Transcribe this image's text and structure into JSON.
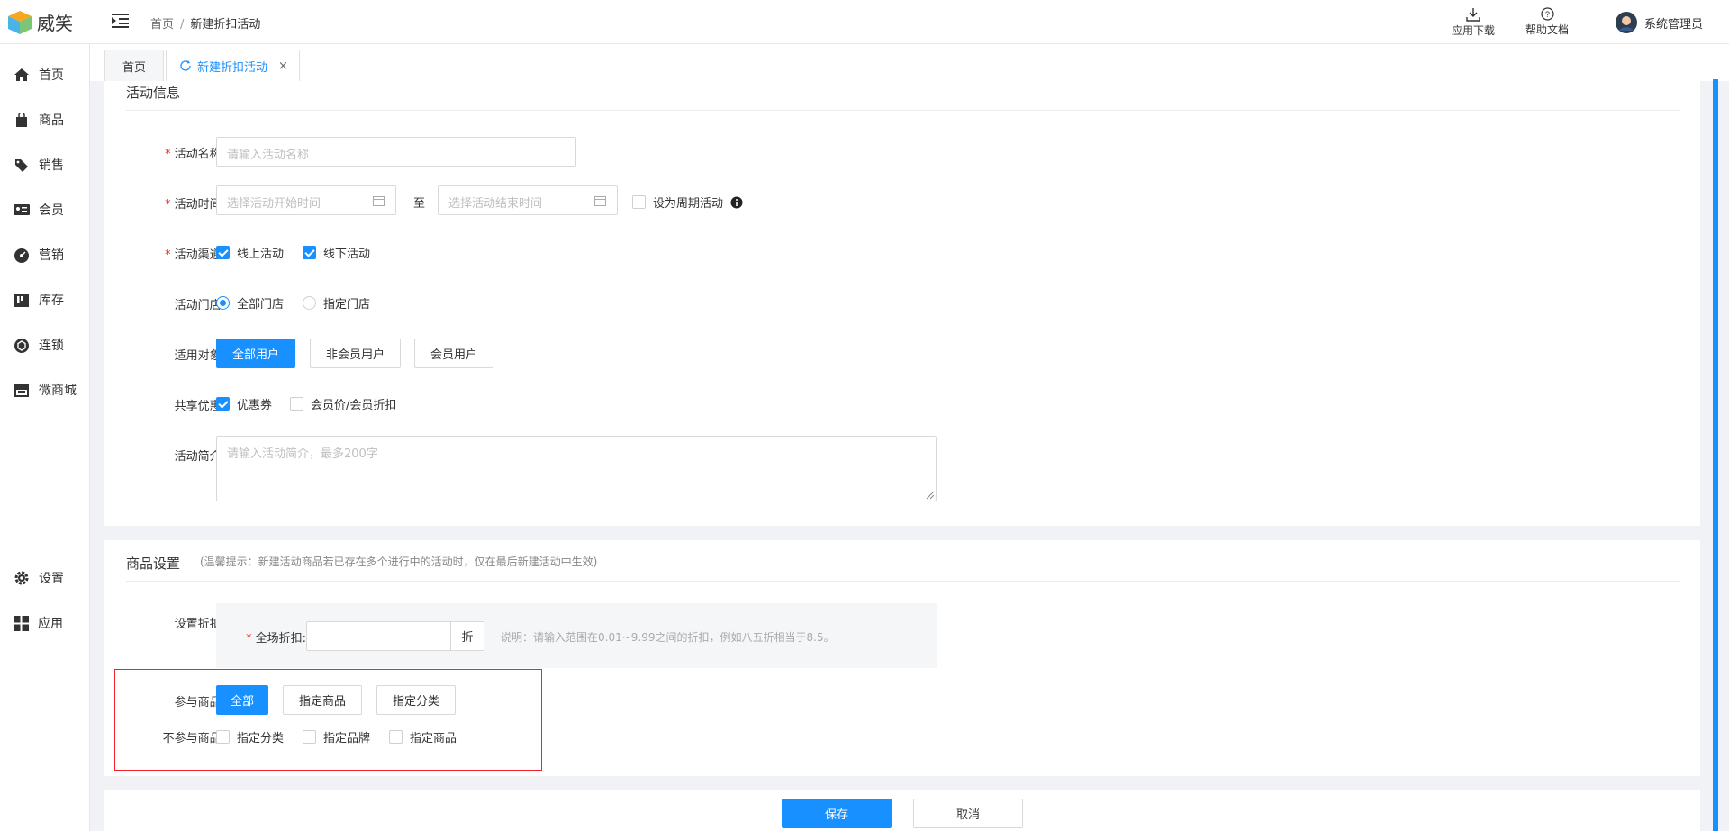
{
  "app": {
    "name": "威笑"
  },
  "header": {
    "breadcrumb": [
      "首页",
      "新建折扣活动"
    ],
    "download_label": "应用下载",
    "help_label": "帮助文档",
    "user_name": "系统管理员"
  },
  "sidebar": {
    "items": [
      {
        "label": "首页",
        "icon": "home-icon"
      },
      {
        "label": "商品",
        "icon": "bag-icon"
      },
      {
        "label": "销售",
        "icon": "tag-icon"
      },
      {
        "label": "会员",
        "icon": "member-card-icon"
      },
      {
        "label": "营销",
        "icon": "dashboard-icon"
      },
      {
        "label": "库存",
        "icon": "inventory-icon"
      },
      {
        "label": "连锁",
        "icon": "chain-icon"
      },
      {
        "label": "微商城",
        "icon": "shop-icon"
      }
    ],
    "bottom_items": [
      {
        "label": "设置",
        "icon": "gear-icon"
      },
      {
        "label": "应用",
        "icon": "apps-icon"
      }
    ]
  },
  "tabs": [
    {
      "label": "首页",
      "active": false
    },
    {
      "label": "新建折扣活动",
      "active": true,
      "close": "×"
    }
  ],
  "activity": {
    "section_title": "活动信息",
    "name_label": "活动名称:",
    "name_placeholder": "请输入活动名称",
    "time_label": "活动时间:",
    "start_placeholder": "选择活动开始时间",
    "to_text": "至",
    "end_placeholder": "选择活动结束时间",
    "periodic_label": "设为周期活动",
    "channel_label": "活动渠道:",
    "channels": [
      {
        "label": "线上活动",
        "checked": true
      },
      {
        "label": "线下活动",
        "checked": true
      }
    ],
    "store_label": "活动门店:",
    "stores": [
      {
        "label": "全部门店",
        "selected": true
      },
      {
        "label": "指定门店",
        "selected": false
      }
    ],
    "target_label": "适用对象:",
    "targets": [
      {
        "label": "全部用户",
        "active": true
      },
      {
        "label": "非会员用户",
        "active": false
      },
      {
        "label": "会员用户",
        "active": false
      }
    ],
    "share_label": "共享优惠:",
    "shares": [
      {
        "label": "优惠券",
        "checked": true
      },
      {
        "label": "会员价/会员折扣",
        "checked": false
      }
    ],
    "intro_label": "活动简介:",
    "intro_placeholder": "请输入活动简介，最多200字"
  },
  "goods": {
    "section_title": "商品设置",
    "tip": "(温馨提示：新建活动商品若已存在多个进行中的活动时，仅在最后新建活动中生效)",
    "discount_label": "设置折扣:",
    "all_discount_label": "全场折扣:",
    "discount_value": "",
    "discount_unit": "折",
    "discount_hint": "说明：请输入范围在0.01~9.99之间的折扣，例如八五折相当于8.5。",
    "join_label": "参与商品:",
    "join_options": [
      {
        "label": "全部",
        "active": true
      },
      {
        "label": "指定商品",
        "active": false
      },
      {
        "label": "指定分类",
        "active": false
      }
    ],
    "exclude_label": "不参与商品:",
    "exclude_options": [
      {
        "label": "指定分类",
        "checked": false
      },
      {
        "label": "指定品牌",
        "checked": false
      },
      {
        "label": "指定商品",
        "checked": false
      }
    ]
  },
  "footer": {
    "save_label": "保存",
    "cancel_label": "取消"
  },
  "colors": {
    "primary": "#1890ff",
    "required": "#f5222d",
    "highlight_border": "#f5222d"
  }
}
